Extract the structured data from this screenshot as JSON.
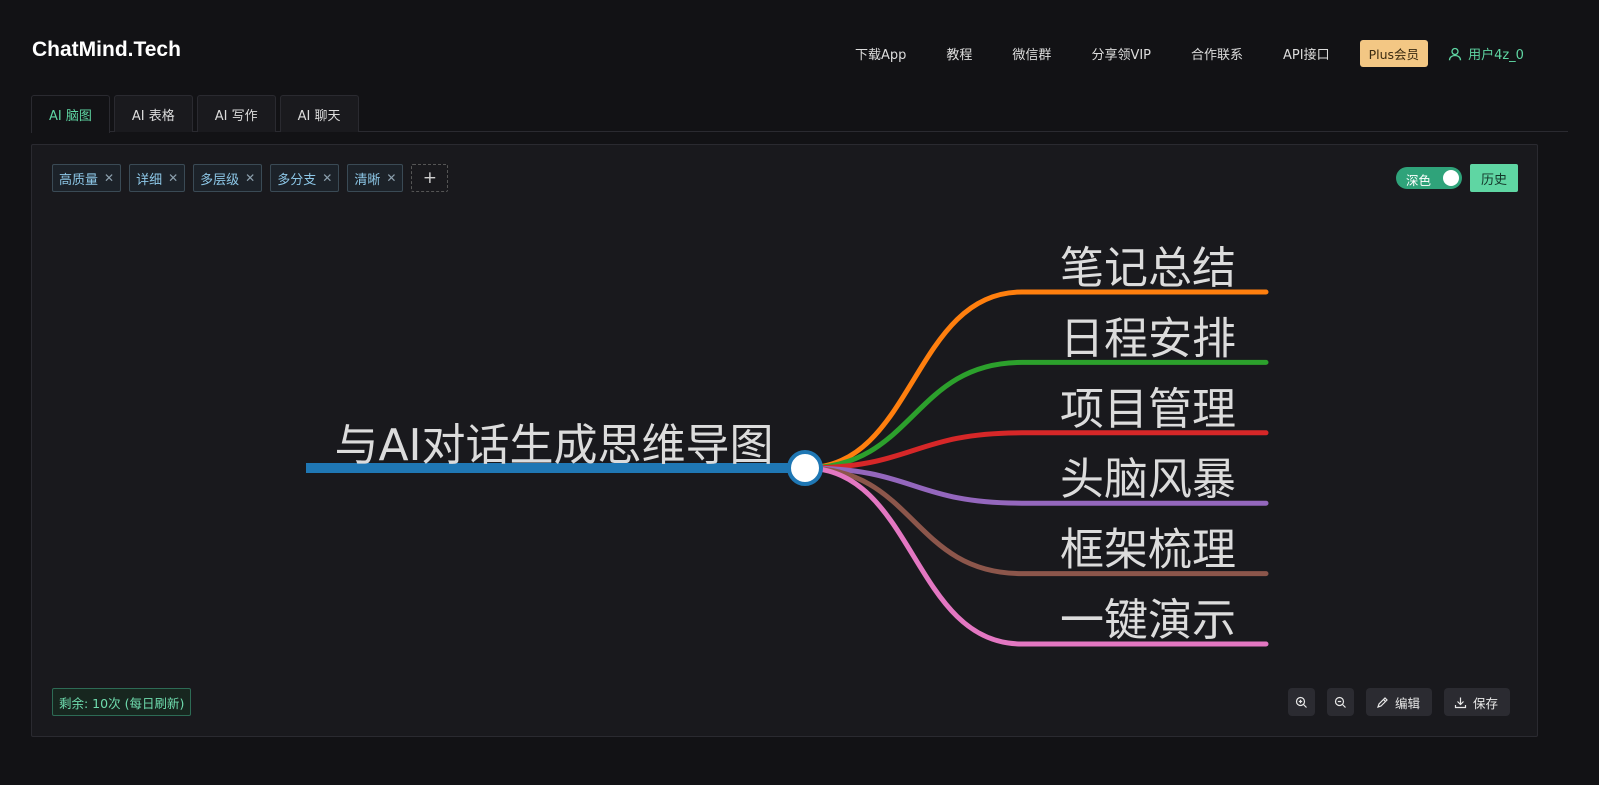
{
  "brand": "ChatMind.Tech",
  "nav": {
    "links": [
      "下载App",
      "教程",
      "微信群",
      "分享领VIP",
      "合作联系",
      "API接口"
    ],
    "plus": "Plus会员",
    "user": "用户4z_0"
  },
  "tabs": [
    "AI 脑图",
    "AI 表格",
    "AI 写作",
    "AI 聊天"
  ],
  "tags": [
    "高质量",
    "详细",
    "多层级",
    "多分支",
    "清晰"
  ],
  "theme_toggle": {
    "label": "深色",
    "on": true
  },
  "history_label": "历史",
  "mindmap": {
    "root": {
      "label": "与AI对话生成思维导图",
      "color": "#1f77b4"
    },
    "branches": [
      {
        "label": "笔记总结",
        "color": "#ff7f0e"
      },
      {
        "label": "日程安排",
        "color": "#2ca02c"
      },
      {
        "label": "项目管理",
        "color": "#d62728"
      },
      {
        "label": "头脑风暴",
        "color": "#9467bd"
      },
      {
        "label": "框架梳理",
        "color": "#8c564b"
      },
      {
        "label": "一键演示",
        "color": "#e377c2"
      }
    ]
  },
  "remaining": "剩余: 10次 (每日刷新)",
  "toolbar": {
    "zoom_in_icon": "zoom-in-icon",
    "zoom_out_icon": "zoom-out-icon",
    "edit": "编辑",
    "save": "保存"
  }
}
